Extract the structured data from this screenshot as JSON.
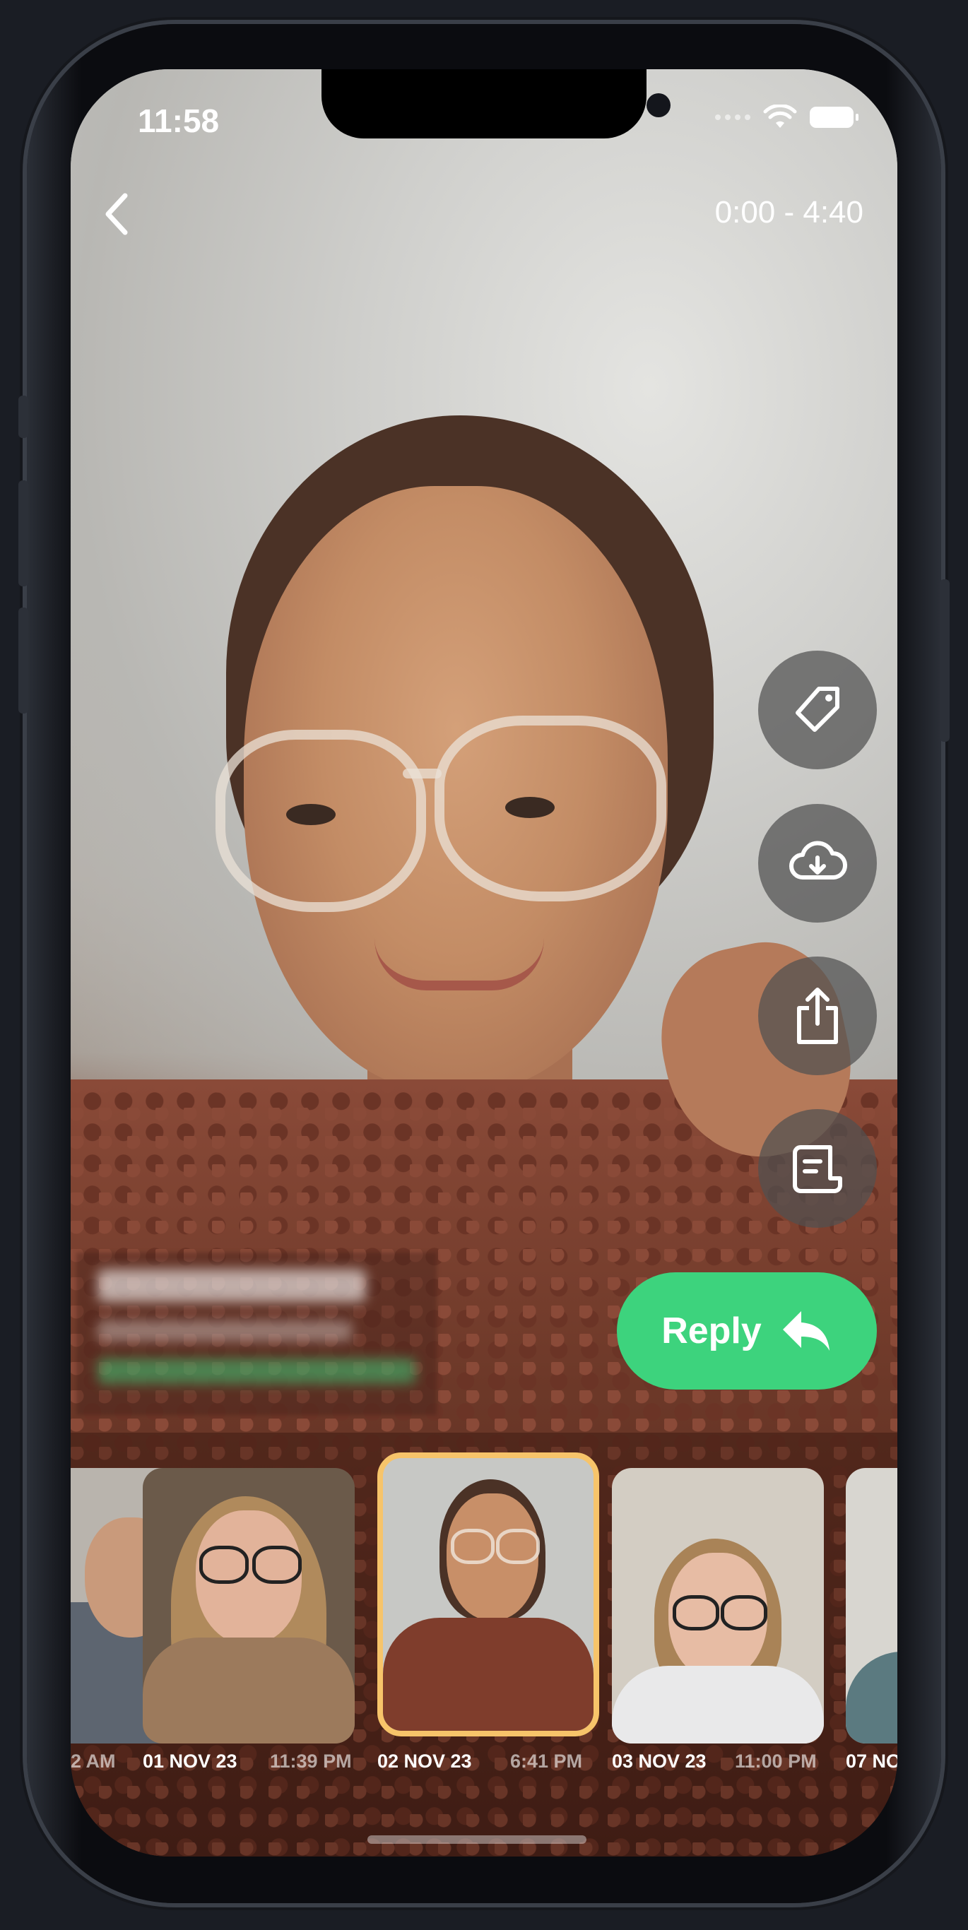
{
  "status_bar": {
    "time": "11:58"
  },
  "header": {
    "back_icon": "chevron-left-icon",
    "duration": "0:00 - 4:40"
  },
  "actions": [
    {
      "name": "tag",
      "icon": "tag-icon"
    },
    {
      "name": "download",
      "icon": "cloud-download-icon"
    },
    {
      "name": "share",
      "icon": "share-icon"
    },
    {
      "name": "transcript",
      "icon": "transcript-icon"
    }
  ],
  "reply": {
    "label": "Reply",
    "icon": "reply-arrow-icon",
    "color": "#3dd37d"
  },
  "thumbnails": [
    {
      "date": "",
      "time": "2 AM"
    },
    {
      "date": "01 NOV 23",
      "time": "11:39 PM"
    },
    {
      "date": "02 NOV 23",
      "time": "6:41 PM",
      "active": true
    },
    {
      "date": "03 NOV 23",
      "time": "11:00 PM"
    },
    {
      "date": "07 NO",
      "time": ""
    }
  ],
  "colors": {
    "active_thumb_border": "#f7c46a"
  }
}
